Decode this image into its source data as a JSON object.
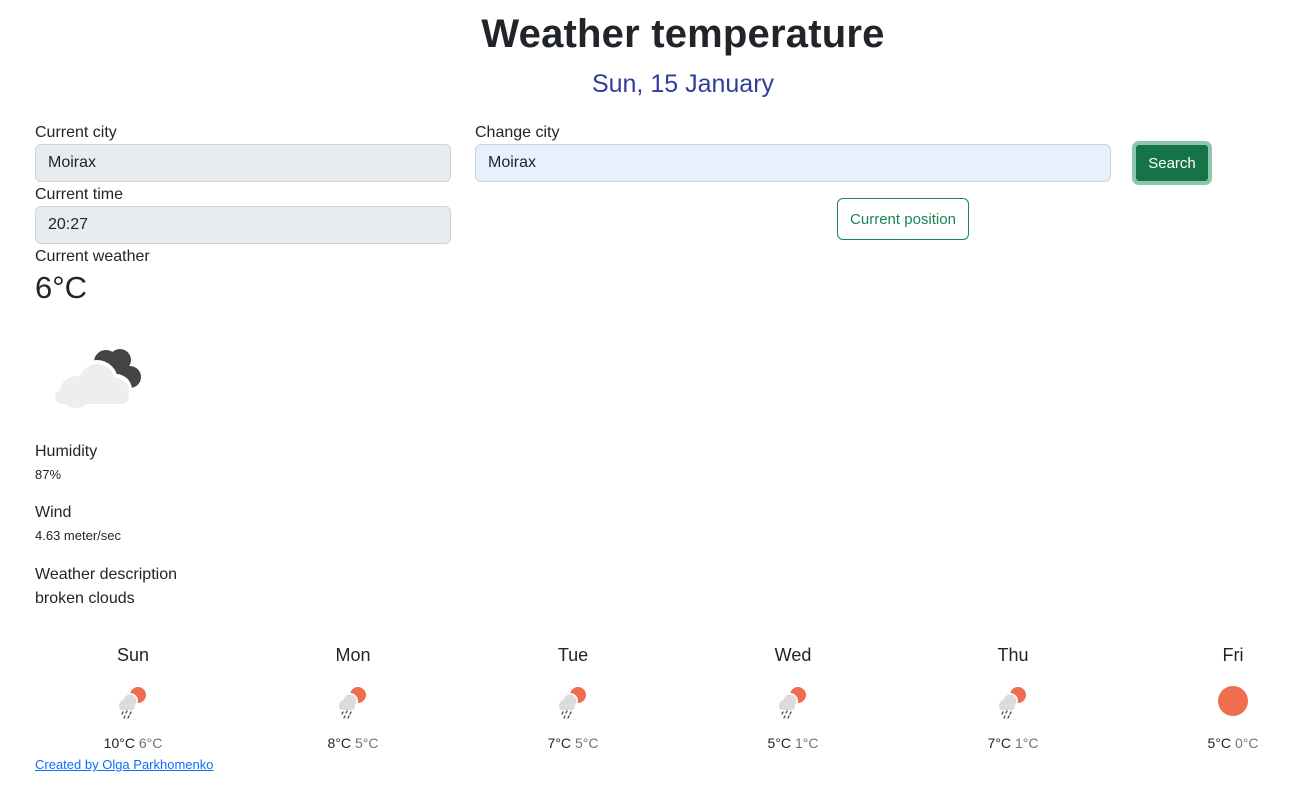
{
  "header": {
    "title": "Weather temperature",
    "date": "Sun, 15 January"
  },
  "current": {
    "city_label": "Current city",
    "city_value": "Moirax",
    "time_label": "Current time",
    "time_value": "20:27",
    "weather_label": "Current weather",
    "temperature": "6°C",
    "icon": "broken-clouds-icon",
    "humidity_label": "Humidity",
    "humidity_value": "87%",
    "wind_label": "Wind",
    "wind_value": "4.63 meter/sec",
    "description_label": "Weather description",
    "description_value": "broken clouds"
  },
  "search": {
    "label": "Change city",
    "value": "Moirax",
    "button": "Search",
    "position_button": "Current position"
  },
  "forecast": [
    {
      "day": "Sun",
      "max": "10°C",
      "min": "6°C",
      "icon": "rain-sun-icon"
    },
    {
      "day": "Mon",
      "max": "8°C",
      "min": "5°C",
      "icon": "rain-sun-icon"
    },
    {
      "day": "Tue",
      "max": "7°C",
      "min": "5°C",
      "icon": "rain-sun-icon"
    },
    {
      "day": "Wed",
      "max": "5°C",
      "min": "1°C",
      "icon": "rain-sun-icon"
    },
    {
      "day": "Thu",
      "max": "7°C",
      "min": "1°C",
      "icon": "rain-sun-icon"
    },
    {
      "day": "Fri",
      "max": "5°C",
      "min": "0°C",
      "icon": "sun-icon"
    }
  ],
  "footer": {
    "link": "Created by Olga Parkhomenko"
  },
  "colors": {
    "accent": "#2f3d9c",
    "button_green": "#157347",
    "sun": "#ee6e4f"
  }
}
